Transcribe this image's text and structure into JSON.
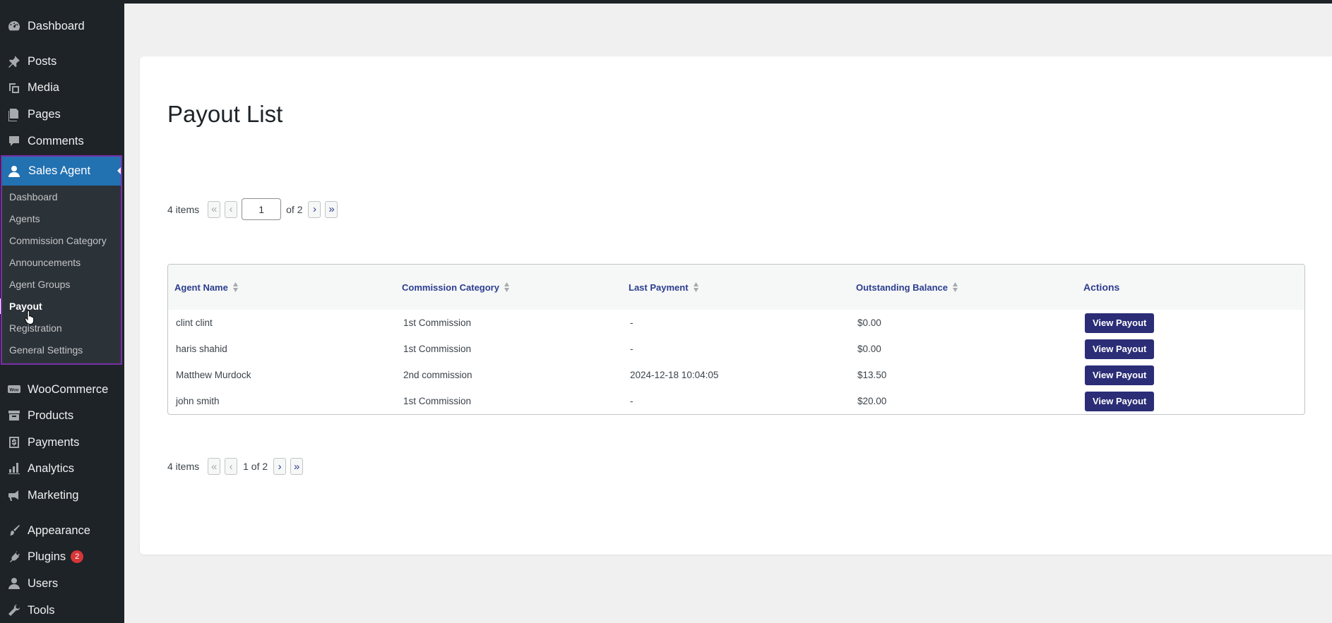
{
  "sidebar": {
    "items_top": [
      {
        "label": "Dashboard",
        "icon": "dashboard-icon"
      },
      {
        "label": "Posts",
        "icon": "pin-icon"
      },
      {
        "label": "Media",
        "icon": "media-icon"
      },
      {
        "label": "Pages",
        "icon": "pages-icon"
      },
      {
        "label": "Comments",
        "icon": "comment-icon"
      }
    ],
    "sales_agent": {
      "label": "Sales Agent",
      "icon": "agent-icon",
      "submenu": [
        "Dashboard",
        "Agents",
        "Commission Category",
        "Announcements",
        "Agent Groups",
        "Payout",
        "Registration",
        "General Settings"
      ],
      "current": "Payout"
    },
    "items_bottom": [
      {
        "label": "WooCommerce",
        "icon": "woo-icon"
      },
      {
        "label": "Products",
        "icon": "archive-icon"
      },
      {
        "label": "Payments",
        "icon": "dollar-icon"
      },
      {
        "label": "Analytics",
        "icon": "bar-chart-icon"
      },
      {
        "label": "Marketing",
        "icon": "megaphone-icon"
      },
      {
        "label": "Appearance",
        "icon": "brush-icon"
      },
      {
        "label": "Plugins",
        "icon": "plug-icon",
        "badge": "2"
      },
      {
        "label": "Users",
        "icon": "user-icon"
      },
      {
        "label": "Tools",
        "icon": "wrench-icon"
      }
    ]
  },
  "page": {
    "title": "Payout List"
  },
  "pagination_top": {
    "items_text": "4 items",
    "first": "«",
    "prev": "‹",
    "current_page": "1",
    "of_text": "of 2",
    "next": "›",
    "last": "»"
  },
  "pagination_bottom": {
    "items_text": "4 items",
    "first": "«",
    "prev": "‹",
    "page_text": "1 of 2",
    "next": "›",
    "last": "»"
  },
  "table": {
    "columns": [
      "Agent Name",
      "Commission Category",
      "Last Payment",
      "Outstanding Balance",
      "Actions"
    ],
    "rows": [
      {
        "agent": "clint clint",
        "category": "1st Commission",
        "last_payment": "-",
        "balance": "$0.00",
        "action": "View Payout"
      },
      {
        "agent": "haris shahid",
        "category": "1st Commission",
        "last_payment": "-",
        "balance": "$0.00",
        "action": "View Payout"
      },
      {
        "agent": "Matthew Murdock",
        "category": "2nd commission",
        "last_payment": "2024-12-18 10:04:05",
        "balance": "$13.50",
        "action": "View Payout"
      },
      {
        "agent": "john smith",
        "category": "1st Commission",
        "last_payment": "-",
        "balance": "$20.00",
        "action": "View Payout"
      }
    ]
  },
  "colors": {
    "sidebar_bg": "#1d2327",
    "sidebar_active": "#2271b1",
    "highlight_border": "#7a2fa8",
    "button_bg": "#2b2d77",
    "header_text": "#2c3e8f"
  }
}
